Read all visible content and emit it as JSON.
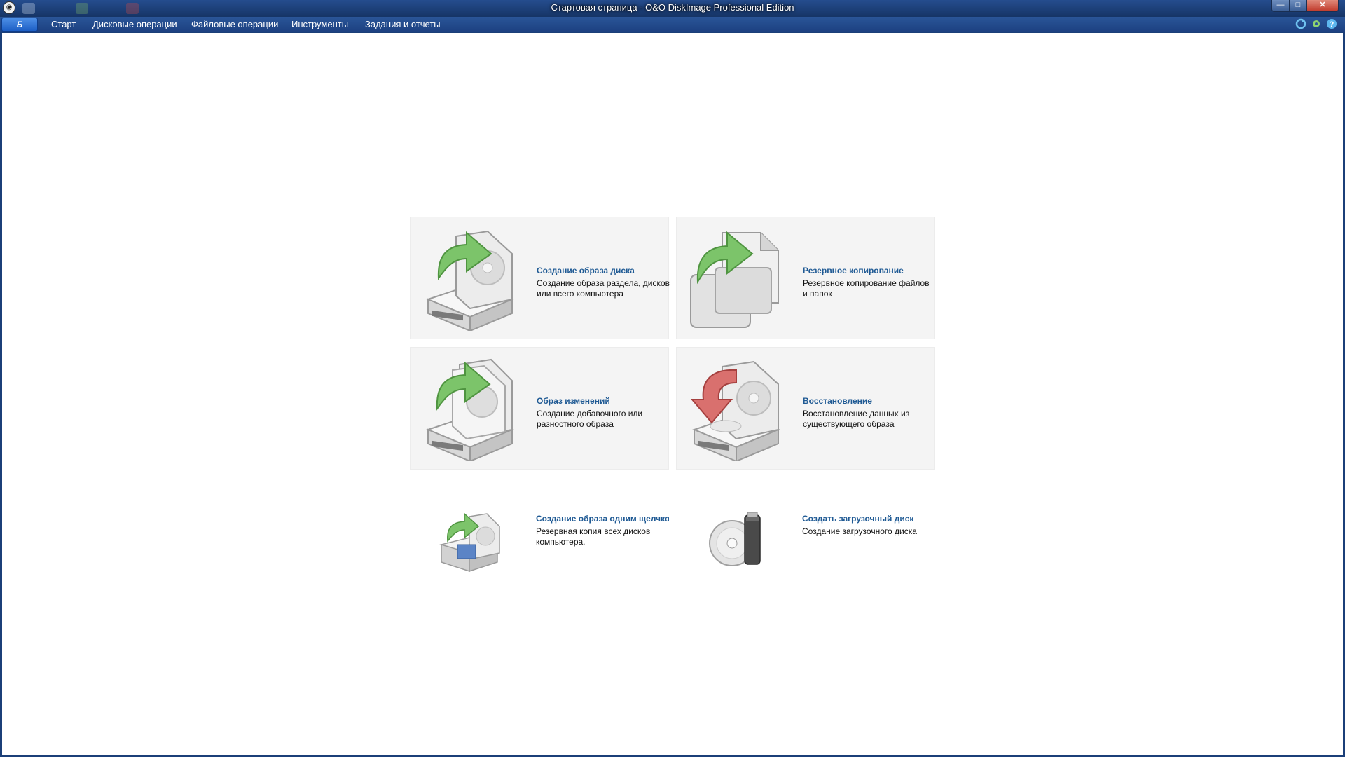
{
  "window": {
    "title": "Стартовая страница - O&O DiskImage Professional Edition",
    "app_button_label": "Б",
    "min_glyph": "—",
    "max_glyph": "□",
    "close_glyph": "✕"
  },
  "menu": {
    "items": [
      {
        "label": "Старт"
      },
      {
        "label": "Дисковые операции"
      },
      {
        "label": "Файловые операции"
      },
      {
        "label": "Инструменты"
      },
      {
        "label": "Задания и отчеты"
      }
    ]
  },
  "tiles": [
    {
      "title": "Создание образа диска",
      "desc": "Создание образа раздела, дисков или всего компьютера",
      "icon": "disk-image-icon"
    },
    {
      "title": "Резервное копирование",
      "desc": "Резервное копирование файлов и папок",
      "icon": "file-backup-icon"
    },
    {
      "title": "Образ изменений",
      "desc": "Создание добавочного или разностного образа",
      "icon": "incremental-image-icon"
    },
    {
      "title": "Восстановление",
      "desc": "Восстановление данных из существующего образа",
      "icon": "restore-icon"
    }
  ],
  "quick": [
    {
      "title": "Создание образа одним щелчком",
      "desc": "Резервная копия всех дисков компьютера.",
      "icon": "one-click-image-icon"
    },
    {
      "title": "Создать загрузочный диск",
      "desc": "Создание загрузочного диска",
      "icon": "bootable-media-icon"
    }
  ],
  "colors": {
    "link": "#1f5a94",
    "tile_bg": "#f4f4f4",
    "frame": "#1b3f78",
    "arrow_green": "#7cc46a",
    "arrow_red": "#d9706e"
  }
}
